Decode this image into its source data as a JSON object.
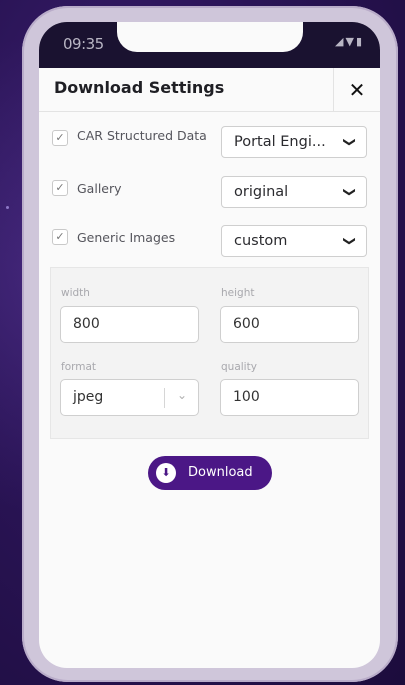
{
  "status": {
    "time": "09:35"
  },
  "dialog": {
    "title": "Download Settings",
    "close_label": "✕"
  },
  "options": [
    {
      "label": "CAR Structured Data",
      "checked": true,
      "select_value": "Portal Engi..."
    },
    {
      "label": "Gallery",
      "checked": true,
      "select_value": "original"
    },
    {
      "label": "Generic Images",
      "checked": true,
      "select_value": "custom"
    }
  ],
  "custom": {
    "width_label": "width",
    "width_value": "800",
    "height_label": "height",
    "height_value": "600",
    "format_label": "format",
    "format_value": "jpeg",
    "quality_label": "quality",
    "quality_value": "100"
  },
  "download": {
    "label": "Download",
    "icon": "download-circle-icon"
  },
  "colors": {
    "accent": "#4b1786",
    "background": "#2a1456"
  }
}
